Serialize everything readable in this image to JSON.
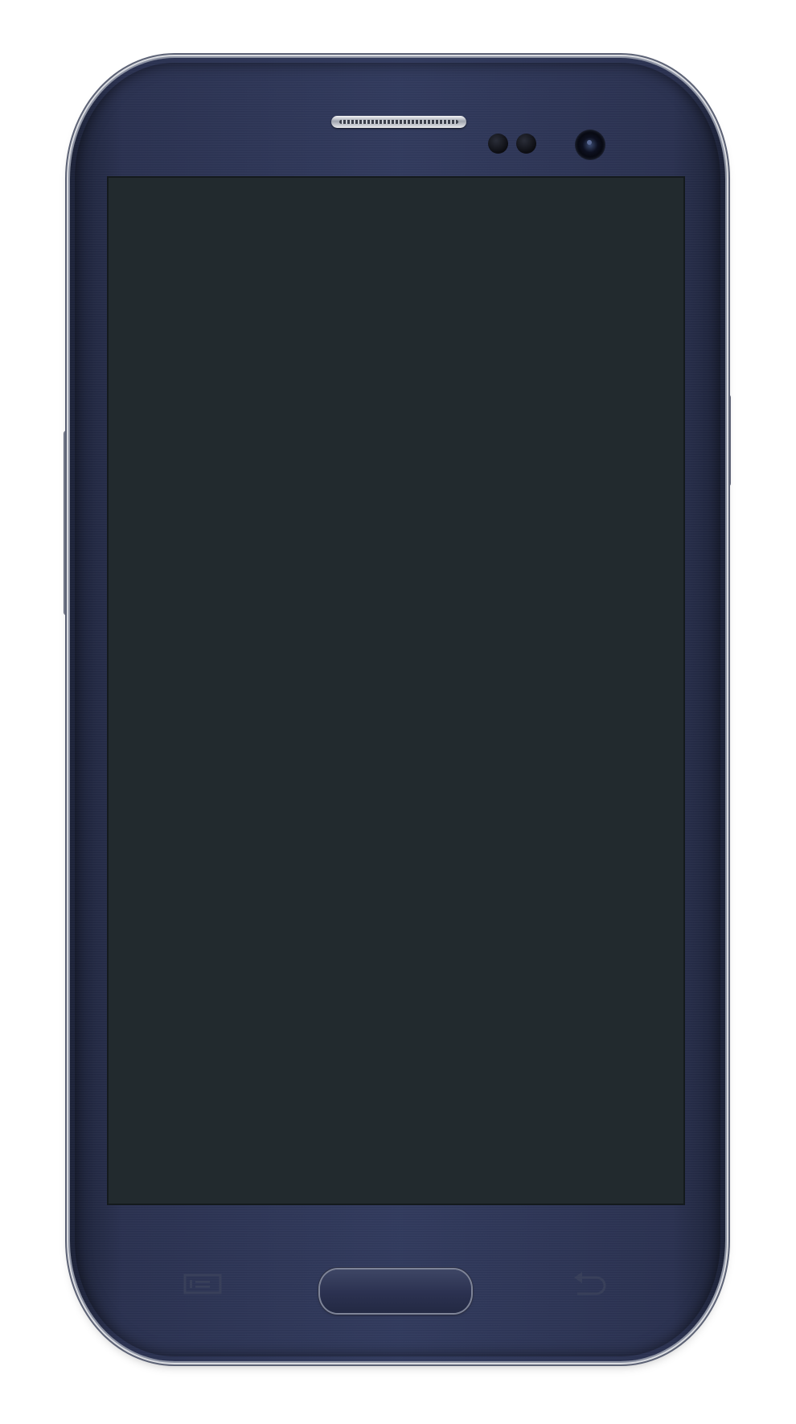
{
  "device": {
    "body_color": "#313a5d",
    "screen_color": "#222a2e",
    "bezel_trim_color": "#8d93a3"
  },
  "hardware_keys": {
    "menu_icon": "menu-icon",
    "home_icon": "home-button",
    "back_icon": "back-arrow-icon"
  }
}
